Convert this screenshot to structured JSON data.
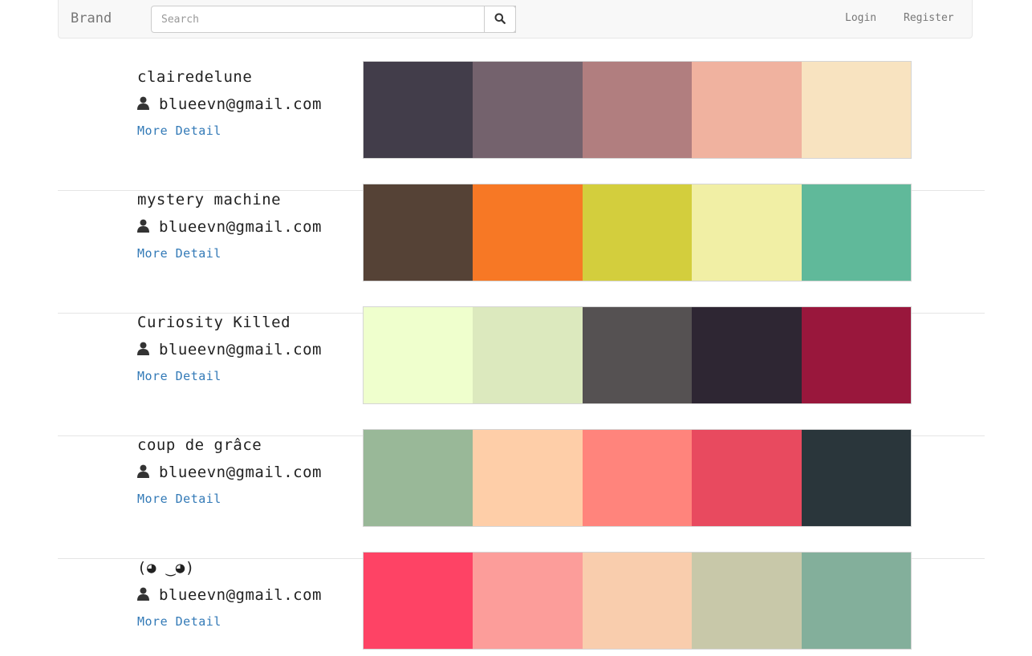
{
  "navbar": {
    "brand": "Brand",
    "search_placeholder": "Search",
    "search_icon": "search-icon",
    "login": "Login",
    "register": "Register"
  },
  "palettes": [
    {
      "title": "clairedelune",
      "author": "blueevn@gmail.com",
      "detail_link": "More Detail",
      "colors": [
        "#423d4a",
        "#74626d",
        "#b17e7f",
        "#f0b29f",
        "#f8e3c0"
      ]
    },
    {
      "title": "mystery machine",
      "author": "blueevn@gmail.com",
      "detail_link": "More Detail",
      "colors": [
        "#554236",
        "#f77825",
        "#d3ce3d",
        "#f1efa5",
        "#60b99a"
      ]
    },
    {
      "title": "Curiosity Killed",
      "author": "blueevn@gmail.com",
      "detail_link": "More Detail",
      "colors": [
        "#efffcd",
        "#dce9be",
        "#555152",
        "#2e2633",
        "#99173c"
      ]
    },
    {
      "title": "coup de grâce",
      "author": "blueevn@gmail.com",
      "detail_link": "More Detail",
      "colors": [
        "#99b898",
        "#fecea8",
        "#ff847c",
        "#e84a5f",
        "#2a363b"
      ]
    },
    {
      "title": "(◕ ‿◕)",
      "author": "blueevn@gmail.com",
      "detail_link": "More Detail",
      "colors": [
        "#fe4365",
        "#fc9d9a",
        "#f9cdad",
        "#c8c8a9",
        "#83af9b"
      ]
    }
  ],
  "icons": {
    "user": "user-icon"
  }
}
